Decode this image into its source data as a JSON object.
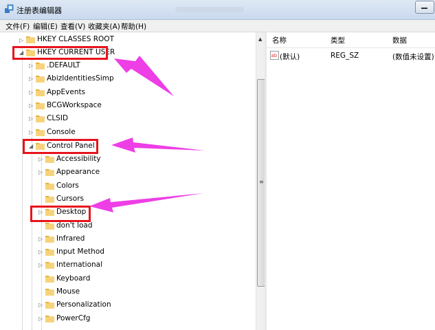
{
  "window": {
    "title": "注册表编辑器"
  },
  "menu": [
    {
      "label": "文件(F)"
    },
    {
      "label": "编辑(E)"
    },
    {
      "label": "查看(V)"
    },
    {
      "label": "收藏夹(A)"
    },
    {
      "label": "帮助(H)"
    }
  ],
  "tree": {
    "root_classes": "HKEY CLASSES ROOT",
    "current_user": "HKEY CURRENT USER",
    "hkcu_children": [
      ".DEFAULT",
      "AbizIdentitiesSimp",
      "AppEvents",
      "BCGWorkspace",
      "CLSID",
      "Console"
    ],
    "control_panel": "Control Panel",
    "cp_children": [
      "Accessibility",
      "Appearance",
      "Colors",
      "Cursors",
      "Desktop",
      "don't load",
      "Infrared",
      "Input Method",
      "International",
      "Keyboard",
      "Mouse",
      "Personalization",
      "PowerCfg"
    ]
  },
  "list": {
    "headers": {
      "name": "名称",
      "type": "类型",
      "data": "数据"
    },
    "rows": [
      {
        "name": "(默认)",
        "type": "REG_SZ",
        "data": "(数值未设置)"
      }
    ]
  },
  "colors": {
    "highlight_box": "#e8131b",
    "arrow": "#ee3ee6"
  }
}
